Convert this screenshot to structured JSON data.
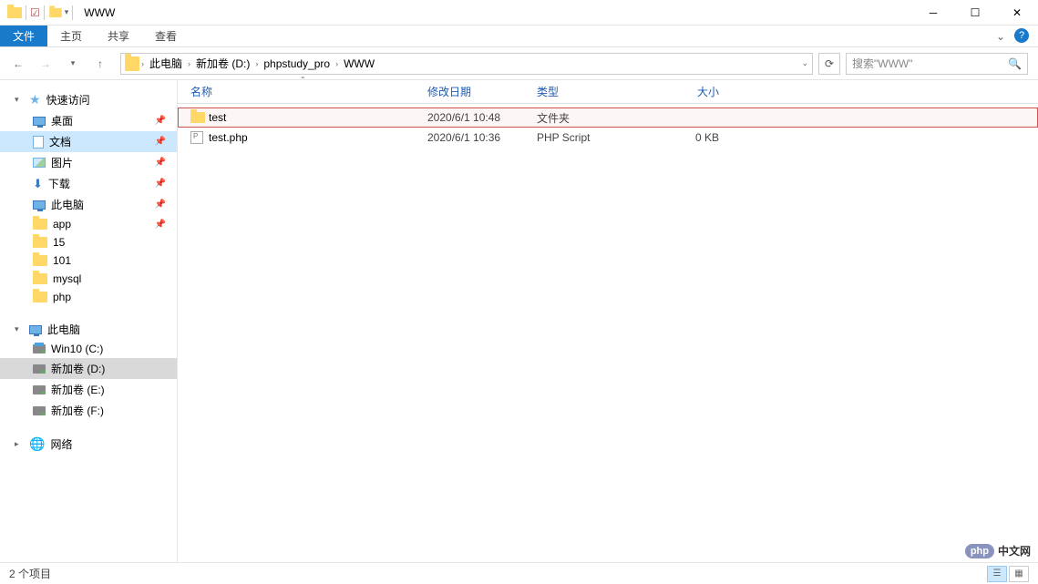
{
  "title_bar": {
    "title": "WWW"
  },
  "ribbon": {
    "file": "文件",
    "home": "主页",
    "share": "共享",
    "view": "查看"
  },
  "nav": {
    "crumbs": [
      "此电脑",
      "新加卷 (D:)",
      "phpstudy_pro",
      "WWW"
    ],
    "search_placeholder": "搜索\"WWW\""
  },
  "sidebar": {
    "quick_access": "快速访问",
    "quick_items": [
      {
        "label": "桌面",
        "icon": "monitor",
        "pinned": true
      },
      {
        "label": "文档",
        "icon": "doc",
        "pinned": true,
        "selected": true
      },
      {
        "label": "图片",
        "icon": "img",
        "pinned": true
      },
      {
        "label": "下载",
        "icon": "dl",
        "pinned": true
      },
      {
        "label": "此电脑",
        "icon": "monitor",
        "pinned": true
      },
      {
        "label": "app",
        "icon": "folder",
        "pinned": true
      },
      {
        "label": "15",
        "icon": "folder"
      },
      {
        "label": "101",
        "icon": "folder"
      },
      {
        "label": "mysql",
        "icon": "folder"
      },
      {
        "label": "php",
        "icon": "folder"
      }
    ],
    "this_pc": "此电脑",
    "drives": [
      {
        "label": "Win10 (C:)",
        "icon": "win"
      },
      {
        "label": "新加卷 (D:)",
        "icon": "disk",
        "active": true
      },
      {
        "label": "新加卷 (E:)",
        "icon": "disk"
      },
      {
        "label": "新加卷 (F:)",
        "icon": "disk"
      }
    ],
    "network": "网络"
  },
  "columns": {
    "name": "名称",
    "date": "修改日期",
    "type": "类型",
    "size": "大小"
  },
  "files": [
    {
      "name": "test",
      "date": "2020/6/1 10:48",
      "type": "文件夹",
      "size": "",
      "icon": "folder",
      "highlighted": true
    },
    {
      "name": "test.php",
      "date": "2020/6/1 10:36",
      "type": "PHP Script",
      "size": "0 KB",
      "icon": "php"
    }
  ],
  "status": {
    "count": "2 个项目"
  },
  "watermark": {
    "badge": "php",
    "text": "中文网"
  }
}
